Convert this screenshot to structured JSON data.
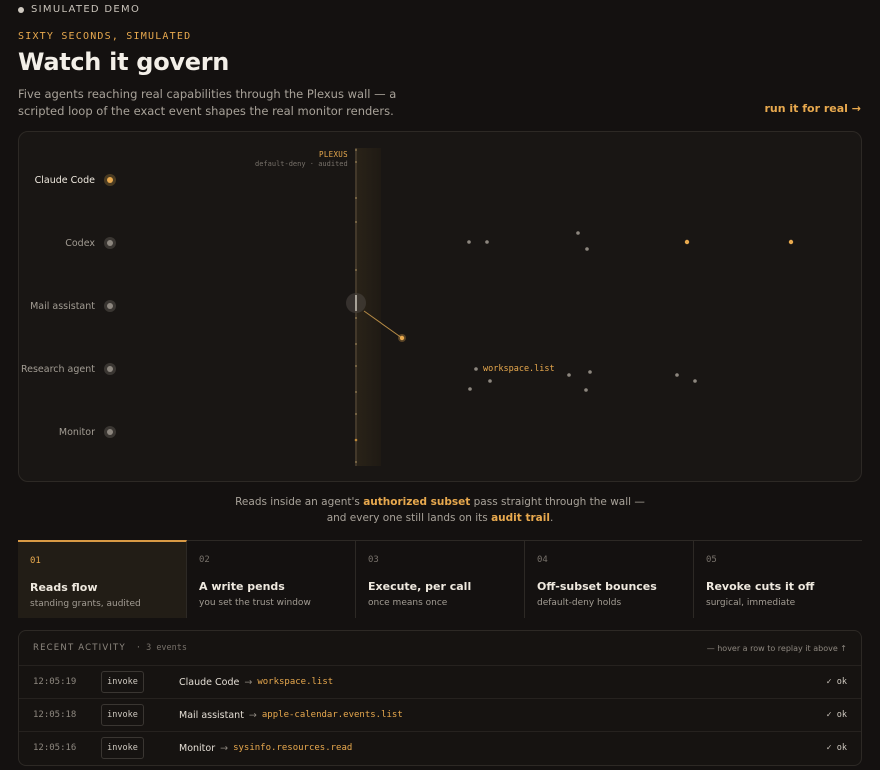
{
  "header": {
    "demo_tag": "SIMULATED DEMO",
    "eyebrow": "SIXTY SECONDS, SIMULATED",
    "title": "Watch it govern",
    "lede": "Five agents reaching real capabilities through the Plexus wall — a scripted loop of the exact event shapes the real monitor renders.",
    "run_link": "run it for real →"
  },
  "stage": {
    "wall_name": "PLEXUS",
    "wall_sub": "default-deny · audited",
    "capability_label": "workspace.list",
    "agents": [
      {
        "name": "Claude Code",
        "active": true
      },
      {
        "name": "Codex",
        "active": false
      },
      {
        "name": "Mail assistant",
        "active": false
      },
      {
        "name": "Research agent",
        "active": false
      },
      {
        "name": "Monitor",
        "active": false
      }
    ]
  },
  "caption": {
    "part1": "Reads inside an agent's ",
    "highlight1": "authorized subset",
    "part2": " pass straight through the wall — and every one still lands on its ",
    "highlight2": "audit trail",
    "part3": "."
  },
  "steps": [
    {
      "num": "01",
      "title": "Reads flow",
      "sub": "standing grants, audited",
      "active": true
    },
    {
      "num": "02",
      "title": "A write pends",
      "sub": "you set the trust window",
      "active": false
    },
    {
      "num": "03",
      "title": "Execute, per call",
      "sub": "once means once",
      "active": false
    },
    {
      "num": "04",
      "title": "Off-subset bounces",
      "sub": "default-deny holds",
      "active": false
    },
    {
      "num": "05",
      "title": "Revoke cuts it off",
      "sub": "surgical, immediate",
      "active": false
    }
  ],
  "activity": {
    "title": "RECENT ACTIVITY",
    "count": "· 3 events",
    "hint": "— hover a row to replay it above ↑",
    "rows": [
      {
        "time": "12:05:19",
        "type": "invoke",
        "agent": "Claude Code",
        "arrow": "→",
        "capability": "workspace.list",
        "status": "✓ ok"
      },
      {
        "time": "12:05:18",
        "type": "invoke",
        "agent": "Mail assistant",
        "arrow": "→",
        "capability": "apple-calendar.events.list",
        "status": "✓ ok"
      },
      {
        "time": "12:05:16",
        "type": "invoke",
        "agent": "Monitor",
        "arrow": "→",
        "capability": "sysinfo.resources.read",
        "status": "✓ ok"
      }
    ]
  },
  "colors": {
    "accent": "#e8a94e",
    "background": "#141110",
    "panel": "#191614"
  }
}
